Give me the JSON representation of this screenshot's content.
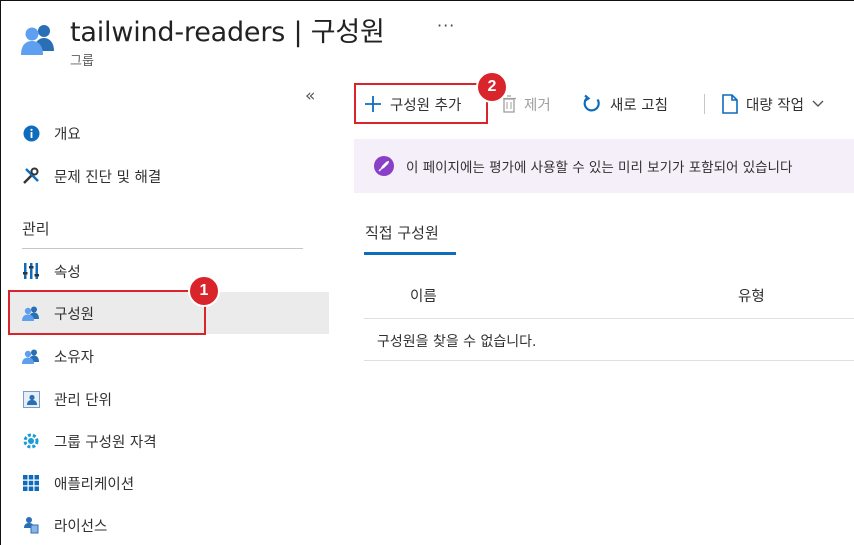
{
  "header": {
    "title": "tailwind-readers | 구성원",
    "subtitle": "그룹",
    "more": "···"
  },
  "sidebar": {
    "collapse_glyph": "«",
    "top_items": [
      {
        "label": "개요",
        "icon": "info-icon"
      },
      {
        "label": "문제 진단 및 해결",
        "icon": "wrench-icon"
      }
    ],
    "section_heading": "관리",
    "manage_items": [
      {
        "label": "속성",
        "icon": "properties-icon"
      },
      {
        "label": "구성원",
        "icon": "members-icon",
        "selected": true
      },
      {
        "label": "소유자",
        "icon": "owners-icon"
      },
      {
        "label": "관리 단위",
        "icon": "admin-units-icon"
      },
      {
        "label": "그룹 구성원 자격",
        "icon": "group-membership-icon"
      },
      {
        "label": "애플리케이션",
        "icon": "applications-icon"
      },
      {
        "label": "라이선스",
        "icon": "licenses-icon"
      }
    ]
  },
  "toolbar": {
    "add_members": "구성원 추가",
    "remove": "제거",
    "refresh": "새로 고침",
    "bulk_operations": "대량 작업"
  },
  "banner": {
    "text": "이 페이지에는 평가에 사용할 수 있는 미리 보기가 포함되어 있습니다"
  },
  "tabs": [
    {
      "label": "직접 구성원",
      "active": true
    }
  ],
  "table": {
    "columns": [
      "이름",
      "유형"
    ],
    "empty_message": "구성원을 찾을 수 없습니다."
  },
  "callouts": [
    "1",
    "2"
  ],
  "colors": {
    "callout_red": "#d9242b",
    "accent_blue": "#0f6cbd",
    "banner_bg": "#f4eff8",
    "selected_bg": "#ebebeb"
  }
}
